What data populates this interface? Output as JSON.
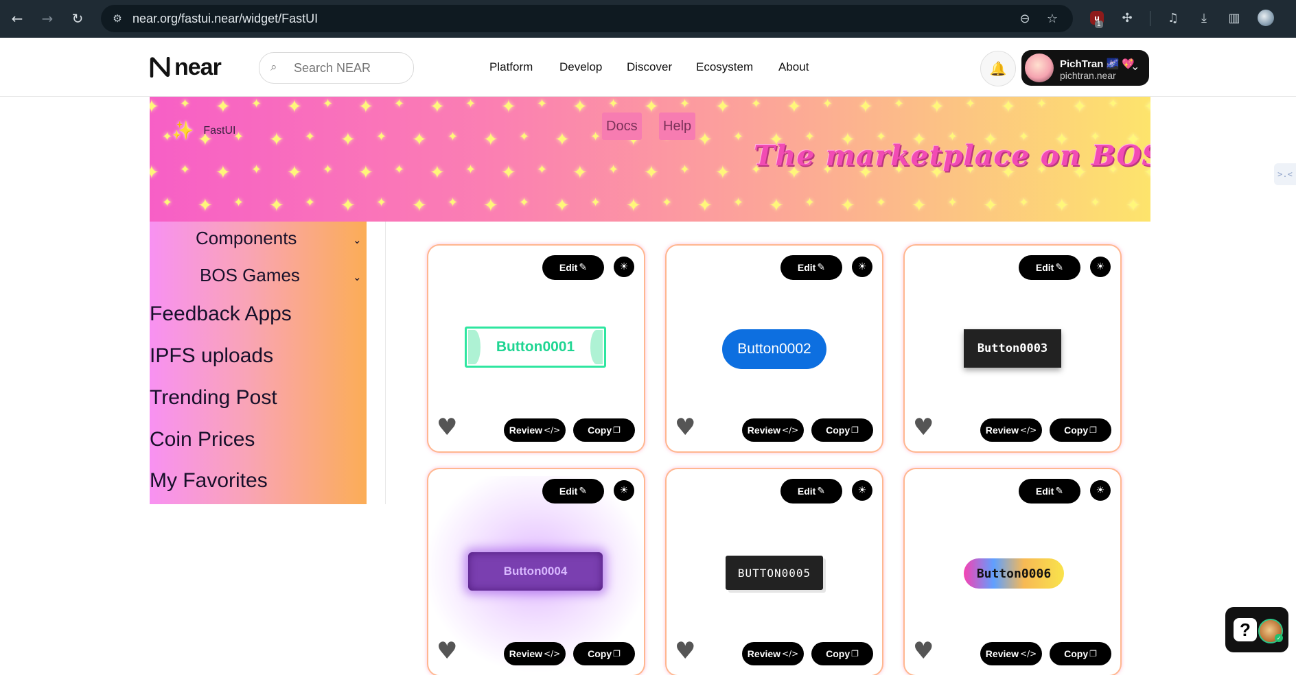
{
  "browser": {
    "url": "near.org/fastui.near/widget/FastUI",
    "back_icon": "←",
    "forward_icon": "→",
    "reload_icon": "↻",
    "site_settings_icon": "⚙",
    "zoom_icon": "⊖",
    "bookmark_icon": "☆",
    "ublock_label": "u",
    "ublock_badge": "1",
    "extensions_icon": "✣",
    "media_icon": "♫",
    "download_icon": "⤓",
    "sidepanel_icon": "▥"
  },
  "header": {
    "logo_text": "near",
    "search_placeholder": "Search NEAR",
    "search_icon": "⌕",
    "nav": [
      "Platform",
      "Develop",
      "Discover",
      "Ecosystem",
      "About"
    ],
    "bell_icon": "🔔",
    "account": {
      "name": "PichTran 🌌 💖",
      "id": "pichtran.near",
      "chevron": "⌄"
    }
  },
  "banner": {
    "brand_icon": "✨",
    "brand": "FastUI",
    "nav": [
      "Docs",
      "Help"
    ],
    "tagline": "The marketplace on BOS"
  },
  "sidebar": {
    "submenus": [
      {
        "label": "Components",
        "chevron": "⌄"
      },
      {
        "label": "BOS Games",
        "chevron": "⌄"
      }
    ],
    "items": [
      "Feedback Apps",
      "IPFS uploads",
      "Trending Post",
      "Coin Prices",
      "My Favorites"
    ]
  },
  "cards": [
    {
      "demo_label": "Button0001"
    },
    {
      "demo_label": "Button0002"
    },
    {
      "demo_label": "Button0003"
    },
    {
      "demo_label": "Button0004"
    },
    {
      "demo_label": "BUTTON0005"
    },
    {
      "demo_label": "Button0006"
    }
  ],
  "card_actions": {
    "edit": "Edit",
    "edit_icon": "✎",
    "theme_icon": "☀",
    "favorite_icon": "♥",
    "review": "Review",
    "review_icon": "</>",
    "copy": "Copy",
    "copy_icon": "❐"
  },
  "widgets": {
    "edge_tab": ">.<",
    "help_label": "?",
    "help_check": "✓"
  },
  "colors": {
    "banner_gradient": [
      "#f75fc6",
      "#fb80b2",
      "#fcaa95",
      "#fde46c"
    ],
    "sidebar_gradient": [
      "#f891f2",
      "#f9a4b6",
      "#fbad56"
    ],
    "card_border": "#ffb78f"
  }
}
